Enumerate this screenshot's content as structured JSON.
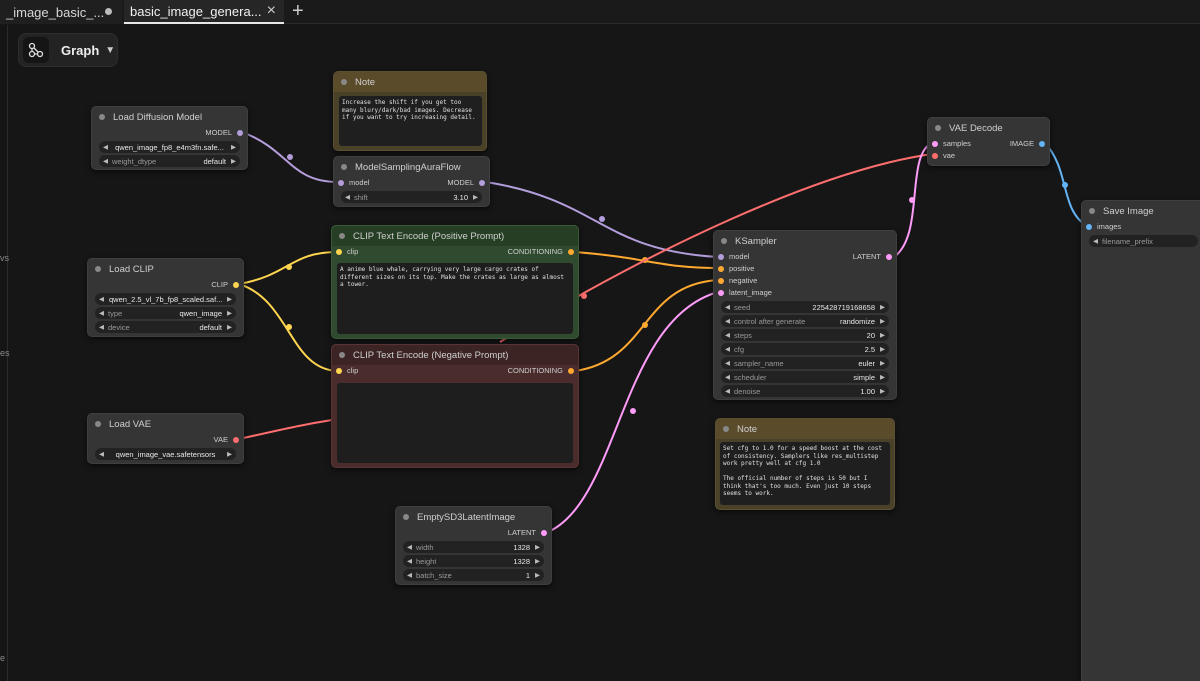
{
  "tabs": [
    {
      "label": "_image_basic_...",
      "state": "unsaved-dot"
    },
    {
      "label": "basic_image_genera...",
      "state": "active"
    }
  ],
  "new_tab_icon": "plus-icon",
  "graph_selector": {
    "label": "Graph",
    "icon": "graph-icon"
  },
  "gutter_marks": [
    "vs",
    "es",
    "e"
  ],
  "colors": {
    "model": "#b39ddb",
    "clip": "#ffd54f",
    "conditioning": "#ffa931",
    "vae": "#ff6e6e",
    "latent": "#ff9cf9",
    "image": "#64b5f6"
  },
  "nodes": {
    "load_diffusion": {
      "title": "Load Diffusion Model",
      "out_model": "MODEL",
      "unet_name": "qwen_image_fp8_e4m3fn.safe...",
      "weight_dtype_label": "weight_dtype",
      "weight_dtype": "default"
    },
    "note_top": {
      "title": "Note",
      "text": "Increase the shift if you get too many blury/dark/bad images. Decrease if you want to try increasing detail."
    },
    "model_sampling": {
      "title": "ModelSamplingAuraFlow",
      "in_model": "model",
      "out_model": "MODEL",
      "shift_label": "shift",
      "shift": "3.10"
    },
    "load_clip": {
      "title": "Load CLIP",
      "out_clip": "CLIP",
      "clip_name": "qwen_2.5_vl_7b_fp8_scaled.saf...",
      "type_label": "type",
      "type": "qwen_image",
      "device_label": "device",
      "device": "default"
    },
    "clip_pos": {
      "title": "CLIP Text Encode (Positive Prompt)",
      "in_clip": "clip",
      "out_cond": "CONDITIONING",
      "text": "A anime blue whale, carrying very large cargo crates of different sizes on its top. Make the crates as large as almost a tower."
    },
    "clip_neg": {
      "title": "CLIP Text Encode (Negative Prompt)",
      "in_clip": "clip",
      "out_cond": "CONDITIONING",
      "text": ""
    },
    "load_vae": {
      "title": "Load VAE",
      "out_vae": "VAE",
      "vae_name": "qwen_image_vae.safetensors"
    },
    "empty_latent": {
      "title": "EmptySD3LatentImage",
      "out_latent": "LATENT",
      "width_label": "width",
      "width": "1328",
      "height_label": "height",
      "height": "1328",
      "batch_label": "batch_size",
      "batch": "1"
    },
    "ksampler": {
      "title": "KSampler",
      "in_model": "model",
      "in_positive": "positive",
      "in_negative": "negative",
      "in_latent": "latent_image",
      "out_latent": "LATENT",
      "seed_label": "seed",
      "seed": "225428719168658",
      "control_label": "control after generate",
      "control": "randomize",
      "steps_label": "steps",
      "steps": "20",
      "cfg_label": "cfg",
      "cfg": "2.5",
      "sampler_label": "sampler_name",
      "sampler": "euler",
      "scheduler_label": "scheduler",
      "scheduler": "simple",
      "denoise_label": "denoise",
      "denoise": "1.00"
    },
    "note_bottom": {
      "title": "Note",
      "text": "Set cfg to 1.0 for a speed boost at the cost of consistency. Samplers like res_multistep work pretty well at cfg 1.0\n\nThe official number of steps is 50 but I think that's too much. Even just 10 steps seems to work."
    },
    "vae_decode": {
      "title": "VAE Decode",
      "in_samples": "samples",
      "in_vae": "vae",
      "out_image": "IMAGE"
    },
    "save_image": {
      "title": "Save Image",
      "in_images": "images",
      "prefix_label": "filename_prefix"
    }
  }
}
